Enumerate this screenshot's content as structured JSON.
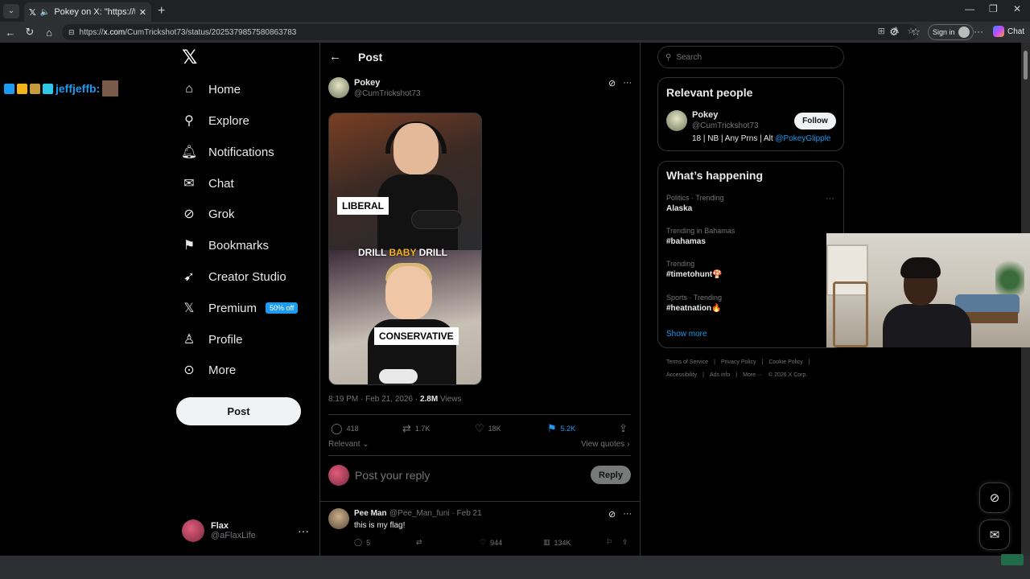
{
  "browser": {
    "tab_title": "Pokey on X: \"https://t.co/FpT",
    "url_prefix": "https://",
    "url_host": "x.com",
    "url_path": "/CumTrickshot73/status/2025379857580863783",
    "signin_label": "Sign in",
    "chat_label": "Chat"
  },
  "overlay": {
    "username": "jeffjeffb:"
  },
  "nav": {
    "items": [
      {
        "label": "Home",
        "icon": "home-icon"
      },
      {
        "label": "Explore",
        "icon": "search-icon"
      },
      {
        "label": "Notifications",
        "icon": "bell-icon"
      },
      {
        "label": "Chat",
        "icon": "mail-icon"
      },
      {
        "label": "Grok",
        "icon": "grok-icon"
      },
      {
        "label": "Bookmarks",
        "icon": "bookmark-icon"
      },
      {
        "label": "Creator Studio",
        "icon": "rocket-icon"
      },
      {
        "label": "Premium",
        "icon": "x-icon"
      },
      {
        "label": "Profile",
        "icon": "person-icon"
      },
      {
        "label": "More",
        "icon": "more-circle-icon"
      }
    ],
    "premium_badge": "50% off",
    "post_button": "Post",
    "account": {
      "name": "Flax",
      "handle": "@aFlaxLife"
    }
  },
  "post": {
    "header_title": "Post",
    "author": {
      "name": "Pokey",
      "handle": "@CumTrickshot73"
    },
    "media": {
      "label_top": "LIBERAL",
      "caption_part1": "DRILL ",
      "caption_highlight": "BABY",
      "caption_part2": " DRILL",
      "label_bottom": "CONSERVATIVE"
    },
    "timestamp": "8:19 PM · Feb 21, 2026 · ",
    "views_count": "2.8M",
    "views_label": " Views",
    "stats": {
      "replies": "418",
      "reposts": "1.7K",
      "likes": "18K",
      "bookmarks": "5.2K"
    },
    "sort_label": "Relevant",
    "view_quotes": "View quotes",
    "reply_placeholder": "Post your reply",
    "reply_button": "Reply"
  },
  "comment": {
    "name": "Pee Man",
    "handle": "@Pee_Man_funi · Feb 21",
    "text": "this is my flag!",
    "replies": "5",
    "likes": "944",
    "views": "134K"
  },
  "sidebar": {
    "search_placeholder": "Search",
    "relevant_people": {
      "title": "Relevant people",
      "name": "Pokey",
      "handle": "@CumTrickshot73",
      "follow_label": "Follow",
      "bio": "18 | NB | Any Prns | Alt ",
      "bio_link": "@PokeyGlipple"
    },
    "happening": {
      "title": "What’s happening",
      "trends": [
        {
          "meta": "Politics · Trending",
          "name": "Alaska"
        },
        {
          "meta": "Trending in Bahamas",
          "name": "#bahamas"
        },
        {
          "meta": "Trending",
          "name": "#timetohunt🍄"
        },
        {
          "meta": "Sports · Trending",
          "name": "#heatnation🔥"
        }
      ],
      "show_more": "Show more"
    },
    "footer_line1": [
      "Terms of Service",
      "|",
      "Privacy Policy",
      "|",
      "Cookie Policy",
      "|"
    ],
    "footer_line2": [
      "Accessibility",
      "|",
      "Ads info",
      "|",
      "More ···",
      "© 2026 X Corp."
    ]
  },
  "colors": {
    "accent": "#1d9bf0",
    "background": "#000000",
    "text": "#e7e9ea",
    "muted": "#71767b"
  }
}
